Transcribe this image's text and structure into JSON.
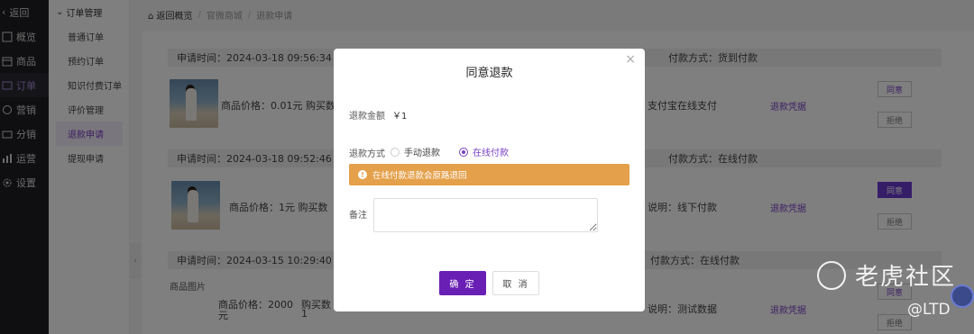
{
  "nav": {
    "back": "返回",
    "items": [
      {
        "label": "概览"
      },
      {
        "label": "商品"
      },
      {
        "label": "订单"
      },
      {
        "label": "营销"
      },
      {
        "label": "分销"
      },
      {
        "label": "运营"
      },
      {
        "label": "设置"
      }
    ]
  },
  "submenu": {
    "title": "订单管理",
    "items": [
      {
        "label": "普通订单"
      },
      {
        "label": "预约订单"
      },
      {
        "label": "知识付费订单"
      },
      {
        "label": "评价管理"
      },
      {
        "label": "退款申请"
      },
      {
        "label": "提现申请"
      }
    ]
  },
  "breadcrumb": {
    "home": "返回概览",
    "shop": "官微商城",
    "current": "退款申请"
  },
  "orders": [
    {
      "apply_time": "申请时间：2024-03-18 09:56:34",
      "pay_type": "付款方式：货到付款",
      "price": "商品价格：0.01元 购买数",
      "method": "支付宝在线支付",
      "voucher": "退款凭据",
      "agree": "同意",
      "reject": "拒绝"
    },
    {
      "apply_time": "申请时间：2024-03-18 09:52:46",
      "pay_type": "付款方式：在线付款",
      "price": "商品价格：1元  购买数",
      "method": "说明：线下付款",
      "voucher": "退款凭据",
      "agree": "同意",
      "reject": "拒绝"
    },
    {
      "apply_time": "申请时间：2024-03-15 10:29:40",
      "pay_type": "付款方式：在线付款",
      "image_alt": "商品图片",
      "price_a": "商品价格：2000",
      "price_b": "元",
      "qty_a": "购买数",
      "qty_b": "1",
      "method": "说明：测试数据",
      "voucher": "退款凭据",
      "agree": "同意",
      "reject": "拒绝"
    }
  ],
  "modal": {
    "title": "同意退款",
    "close": "×",
    "amount_label": "退款金额",
    "amount_value": "￥1",
    "method_label": "退款方式",
    "option_manual": "手动退款",
    "option_online": "在线付款",
    "selected": "在线付款",
    "alert_text": "在线付款退款会原路退回",
    "remark_label": "备注",
    "remark_value": "",
    "ok": "确 定",
    "cancel": "取 消"
  },
  "watermark": {
    "text": "老虎社区",
    "sub": "@LTD"
  },
  "colors": {
    "accent": "#6a1fb4",
    "warning": "#e4a04a",
    "nav_bg": "#1f1f24"
  }
}
